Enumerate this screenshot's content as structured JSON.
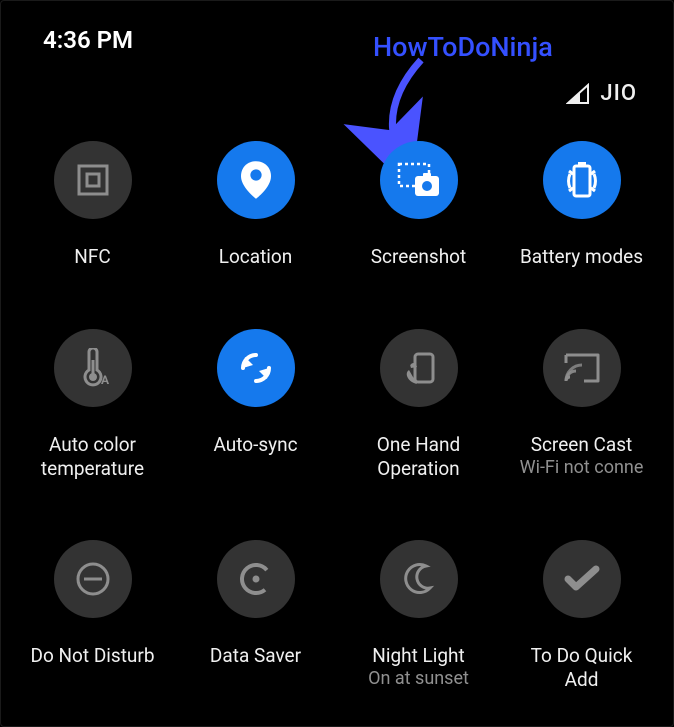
{
  "status": {
    "time": "4:36 PM",
    "carrier": "JIO"
  },
  "watermark": {
    "text": "HowToDoNinja"
  },
  "tiles": {
    "nfc": {
      "label": "NFC",
      "sublabel": ""
    },
    "location": {
      "label": "Location",
      "sublabel": ""
    },
    "screenshot": {
      "label": "Screenshot",
      "sublabel": ""
    },
    "battery": {
      "label": "Battery modes",
      "sublabel": ""
    },
    "autocolor": {
      "label": "Auto color\ntemperature",
      "sublabel": ""
    },
    "autosync": {
      "label": "Auto-sync",
      "sublabel": ""
    },
    "onehand": {
      "label": "One Hand\nOperation",
      "sublabel": ""
    },
    "screencast": {
      "label": "Screen Cast",
      "sublabel": "Wi-Fi not conne"
    },
    "dnd": {
      "label": "Do Not Disturb",
      "sublabel": ""
    },
    "datasaver": {
      "label": "Data Saver",
      "sublabel": ""
    },
    "nightlight": {
      "label": "Night Light",
      "sublabel": "On at sunset"
    },
    "todo": {
      "label": "To Do Quick\nAdd",
      "sublabel": ""
    }
  }
}
